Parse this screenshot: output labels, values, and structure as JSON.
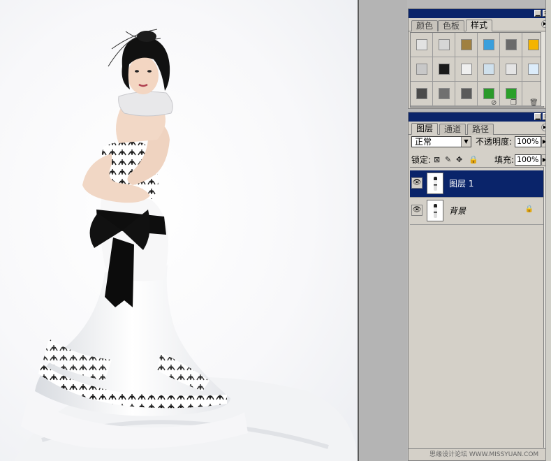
{
  "styles_palette": {
    "tabs": [
      {
        "label": "颜色",
        "active": false
      },
      {
        "label": "色板",
        "active": false
      },
      {
        "label": "样式",
        "active": true
      }
    ],
    "swatches": [
      "#e2e2e2",
      "#d6d6d6",
      "#a08040",
      "#3a9fdc",
      "#6a6a6a",
      "#f4b400",
      "#c8c8c8",
      "#1a1a1a",
      "#efefef",
      "#cfe0ec",
      "#e4e4e4",
      "#dcecfa",
      "#4a4a4a",
      "#707070",
      "#5a5a5a",
      "#2a9a2a",
      "#2aa02a",
      ""
    ]
  },
  "layers_palette": {
    "tabs": [
      {
        "label": "图层",
        "active": true
      },
      {
        "label": "通道",
        "active": false
      },
      {
        "label": "路径",
        "active": false
      }
    ],
    "blend_mode": "正常",
    "opacity_label": "不透明度:",
    "opacity_value": "100%",
    "lock_label": "锁定:",
    "fill_label": "填充:",
    "fill_value": "100%",
    "layers": [
      {
        "name": "图层 1",
        "selected": true,
        "locked": false
      },
      {
        "name": "背景",
        "selected": false,
        "locked": true
      }
    ],
    "watermark": "思缘设计论坛 WWW.MISSYUAN.COM"
  },
  "canvas": {
    "image": "photo-bride-black-white-gown"
  }
}
